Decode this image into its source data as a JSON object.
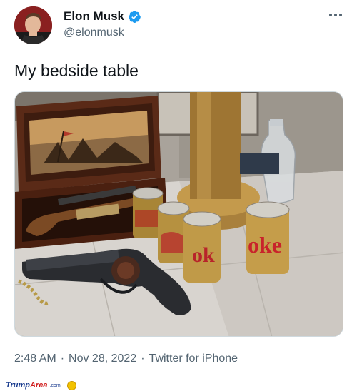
{
  "tweet": {
    "author": {
      "display_name": "Elon Musk",
      "handle": "@elonmusk",
      "verified": true,
      "avatar_icon": "profile-photo"
    },
    "more_icon": "more-horizontal-icon",
    "text": "My bedside table",
    "media": {
      "description_icon": "photo"
    },
    "meta": {
      "time": "2:48 AM",
      "separator": "·",
      "date": "Nov 28, 2022",
      "source": "Twitter for iPhone"
    }
  },
  "watermark": {
    "brand_main": "Trump",
    "brand_accent": "Area",
    "brand_suffix": ".com"
  },
  "colors": {
    "text_primary": "#0f1419",
    "text_secondary": "#536471",
    "verified_blue": "#1d9bf0",
    "watermark_blue": "#1a3c8f",
    "watermark_red": "#d01c1c"
  }
}
